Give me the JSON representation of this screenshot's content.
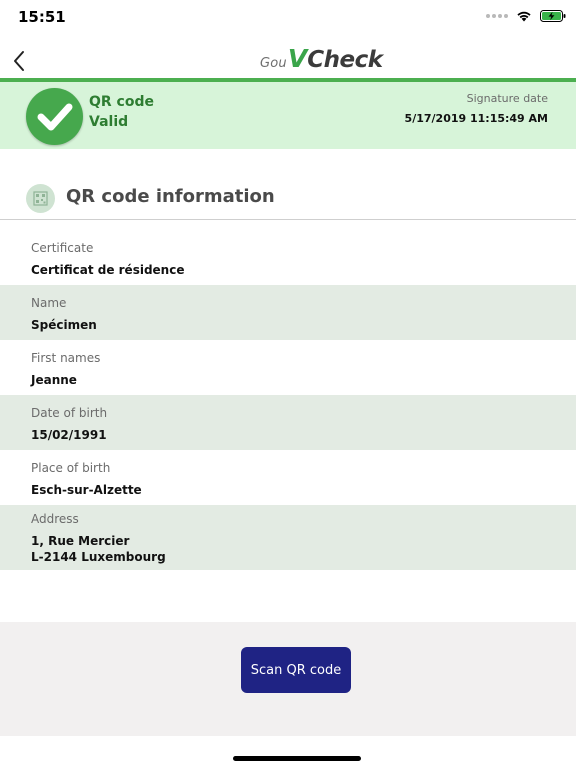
{
  "status_bar": {
    "time": "15:51"
  },
  "nav": {
    "back_icon": "chevron-left-icon",
    "logo_prefix": "Gou",
    "logo_v": "V",
    "logo_suffix": "Check"
  },
  "banner": {
    "icon": "check-icon",
    "title": "QR code",
    "status": "Valid",
    "signature_label": "Signature date",
    "signature_value": "5/17/2019 11:15:49 AM"
  },
  "section": {
    "icon": "qr-code-icon",
    "title": "QR code information"
  },
  "fields": [
    {
      "label": "Certificate",
      "value": "Certificat de résidence"
    },
    {
      "label": "Name",
      "value": "Spécimen"
    },
    {
      "label": "First names",
      "value": "Jeanne"
    },
    {
      "label": "Date of birth",
      "value": "15/02/1991"
    },
    {
      "label": "Place of birth",
      "value": "Esch-sur-Alzette"
    },
    {
      "label": "Address",
      "value_line1": "1, Rue Mercier",
      "value_line2": "L-2144 Luxembourg"
    }
  ],
  "footer": {
    "scan_button_label": "Scan QR code"
  },
  "colors": {
    "accent_green": "#4caf50",
    "banner_bg": "#d7f4d9",
    "row_alt_bg": "#e3ebe3",
    "button_bg": "#1f2384"
  }
}
